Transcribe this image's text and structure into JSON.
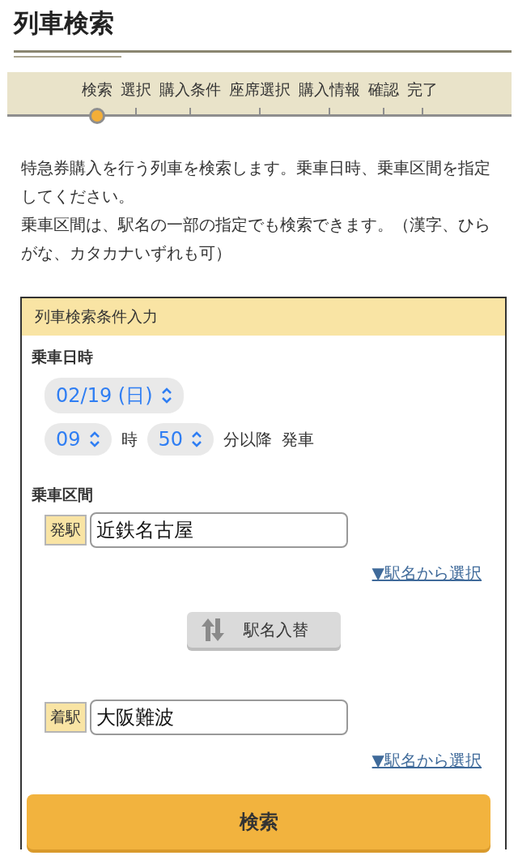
{
  "page_title": "列車検索",
  "steps": [
    {
      "label": "検索",
      "selected": true
    },
    {
      "label": "選択",
      "selected": false
    },
    {
      "label": "購入条件",
      "selected": false
    },
    {
      "label": "座席選択",
      "selected": false
    },
    {
      "label": "購入情報",
      "selected": false
    },
    {
      "label": "確認",
      "selected": false
    },
    {
      "label": "完了",
      "selected": false
    }
  ],
  "intro": [
    "特急券購入を行う列車を検索します。乗車日時、乗車区間を指定してください。",
    "乗車区間は、駅名の一部の指定でも検索できます。（漢字、ひらがな、カタカナいずれも可）"
  ],
  "form": {
    "title": "列車検索条件入力",
    "datetime_label": "乗車日時",
    "date": "02/19 (日)",
    "hour": "09",
    "hour_unit": "時",
    "minute": "50",
    "minute_unit": "分以降",
    "departure_text": "発車",
    "section_label": "乗車区間",
    "from": {
      "tag": "発駅",
      "value": "近鉄名古屋",
      "link": "▼駅名から選択"
    },
    "swap_button": "駅名入替",
    "to": {
      "tag": "着駅",
      "value": "大阪難波",
      "link": "▼駅名から選択"
    },
    "search_button": "検索"
  }
}
